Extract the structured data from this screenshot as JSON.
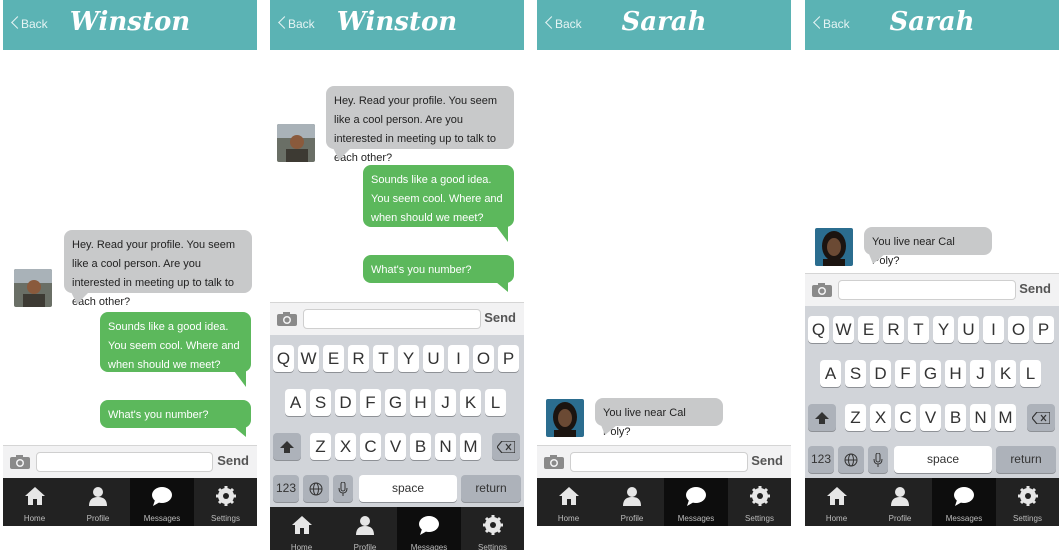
{
  "back_label": "Back",
  "screens": [
    {
      "title": "Winston"
    },
    {
      "title": "Winston"
    },
    {
      "title": "Sarah"
    },
    {
      "title": "Sarah"
    }
  ],
  "messages": {
    "winston_1": "Hey. Read your profile. You seem like a cool person. Are you interested in meeting up to talk to each other?",
    "me_1": "Sounds like a good idea. You seem cool. Where and when should we meet?",
    "me_2": "What's you number?",
    "sarah_1": "You live near Cal Poly?"
  },
  "compose": {
    "send_label": "Send"
  },
  "keyboard": {
    "row1": [
      "Q",
      "W",
      "E",
      "R",
      "T",
      "Y",
      "U",
      "I",
      "O",
      "P"
    ],
    "row2": [
      "A",
      "S",
      "D",
      "F",
      "G",
      "H",
      "J",
      "K",
      "L"
    ],
    "row3": [
      "Z",
      "X",
      "C",
      "V",
      "B",
      "N",
      "M"
    ],
    "numbers_label": "123",
    "space_label": "space",
    "return_label": "return"
  },
  "tabbar": {
    "items": [
      {
        "label": "Home",
        "icon": "home-icon"
      },
      {
        "label": "Profile",
        "icon": "user-icon"
      },
      {
        "label": "Messages",
        "icon": "chat-icon",
        "active": true
      },
      {
        "label": "Settings",
        "icon": "gear-icon"
      }
    ]
  },
  "colors": {
    "header": "#5bb3b4",
    "outgoing": "#5cb85c",
    "incoming": "#c8c9ca",
    "tabbar": "#222222"
  }
}
